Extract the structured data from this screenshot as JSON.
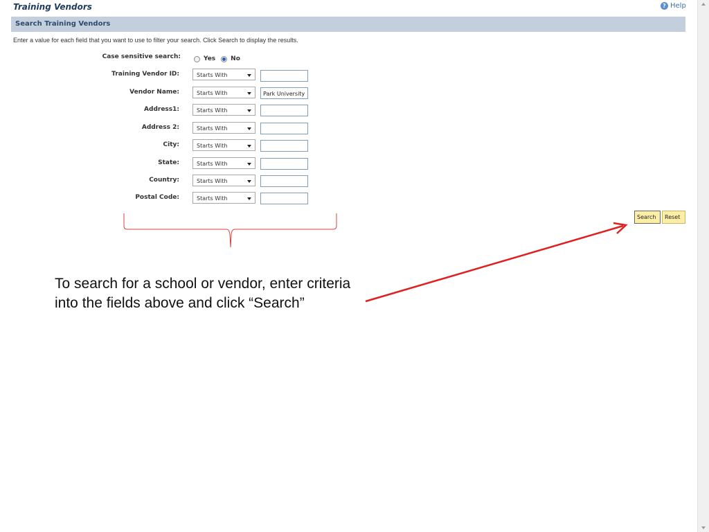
{
  "header": {
    "title": "Training Vendors",
    "help_label": "Help"
  },
  "section": {
    "title": "Search Training Vendors"
  },
  "instructions": "Enter a value for each field that you want to use to filter your search. Click Search to display the results.",
  "case_sensitive": {
    "label": "Case sensitive search:",
    "yes_label": "Yes",
    "no_label": "No",
    "selected": "No"
  },
  "fields": [
    {
      "label": "Training Vendor ID:",
      "operator": "Starts With",
      "value": ""
    },
    {
      "label": "Vendor Name:",
      "operator": "Starts With",
      "value": "Park University"
    },
    {
      "label": "Address1:",
      "operator": "Starts With",
      "value": ""
    },
    {
      "label": "Address 2:",
      "operator": "Starts With",
      "value": ""
    },
    {
      "label": "City:",
      "operator": "Starts With",
      "value": ""
    },
    {
      "label": "State:",
      "operator": "Starts With",
      "value": ""
    },
    {
      "label": "Country:",
      "operator": "Starts With",
      "value": ""
    },
    {
      "label": "Postal Code:",
      "operator": "Starts With",
      "value": ""
    }
  ],
  "buttons": {
    "search": "Search",
    "reset": "Reset"
  },
  "callout": {
    "line1": "To search for a school or vendor, enter criteria",
    "line2": "into the fields above and click “Search”"
  },
  "colors": {
    "arrow": "#e02020",
    "bracket": "#d94040",
    "button_bg": "#fdeea5",
    "section_bar": "#c3cfdc"
  }
}
